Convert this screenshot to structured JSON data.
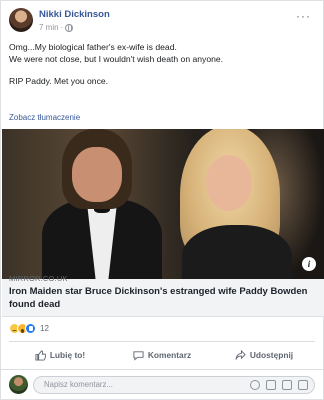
{
  "post": {
    "author": "Nikki Dickinson",
    "time": "7 min",
    "menu_icon": "more-dots-icon",
    "text_lines": [
      "Omg...My biological father's ex-wife is dead.",
      "We were not close, but I wouldn't wish death on anyone.",
      "RIP Paddy. Met you once."
    ],
    "translate_link": "Zobacz tłumaczenie"
  },
  "link_preview": {
    "domain": "MIRROR.CO.UK",
    "headline": "Iron Maiden star Bruce Dickinson's estranged wife Paddy Bowden found dead",
    "info_icon": "i"
  },
  "reactions": {
    "icons": [
      "sad-icon",
      "wow-icon",
      "like-icon"
    ],
    "count": "12"
  },
  "actions": {
    "like": "Lubię to!",
    "comment": "Komentarz",
    "share": "Udostępnij"
  },
  "comment_box": {
    "placeholder": "Napisz komentarz..."
  },
  "colors": {
    "link": "#385898",
    "muted": "#606770",
    "like_blue": "#2078f4"
  }
}
